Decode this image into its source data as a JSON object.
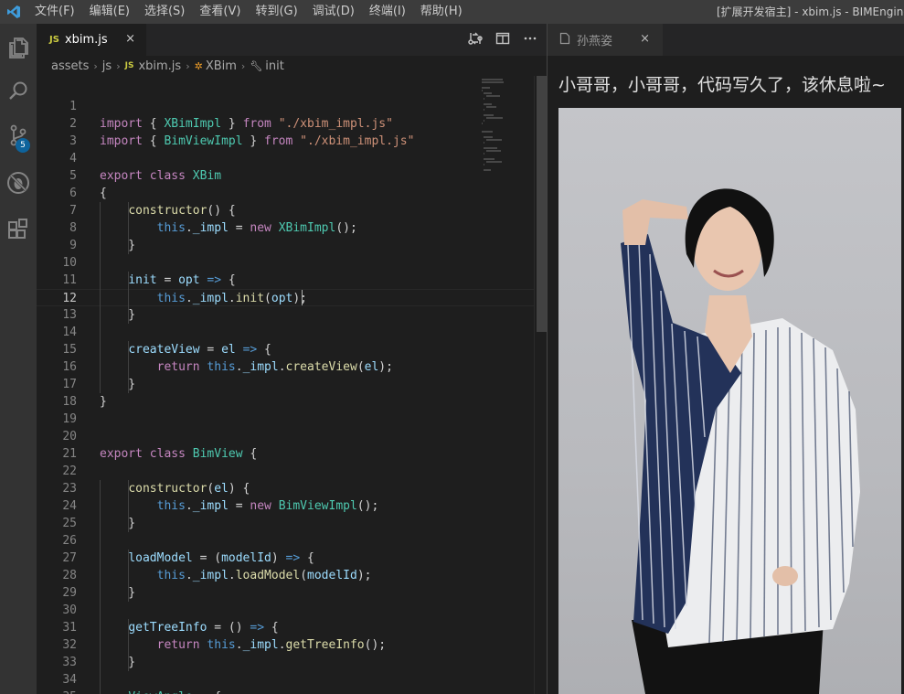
{
  "menu": {
    "items": [
      "文件(F)",
      "编辑(E)",
      "选择(S)",
      "查看(V)",
      "转到(G)",
      "调试(D)",
      "终端(I)",
      "帮助(H)"
    ],
    "window_title": "[扩展开发宿主] - xbim.js - BIMEngineDe"
  },
  "activity_bar": {
    "items": [
      "explorer-icon",
      "search-icon",
      "source-control-icon",
      "debug-icon",
      "extensions-icon"
    ],
    "source_control_badge": "5"
  },
  "editor": {
    "tab": {
      "icon": "JS",
      "label": "xbim.js",
      "close": "×"
    },
    "actions": [
      "compare-changes-icon",
      "split-editor-icon",
      "more-actions-icon"
    ],
    "breadcrumbs": [
      "assets",
      "js",
      "xbim.js",
      "XBim",
      "init"
    ],
    "cursor_line": 12,
    "line_numbers": [
      "1",
      "2",
      "3",
      "4",
      "5",
      "6",
      "7",
      "8",
      "9",
      "10",
      "11",
      "12",
      "13",
      "14",
      "15",
      "16",
      "17",
      "18",
      "19",
      "20",
      "21",
      "22",
      "23",
      "24",
      "25",
      "26",
      "27",
      "28",
      "29",
      "30",
      "31",
      "32",
      "33",
      "34",
      "35"
    ],
    "code_lines": [
      "",
      "import { XBimImpl } from \"./xbim_impl.js\"",
      "import { BimViewImpl } from \"./xbim_impl.js\"",
      "",
      "export class XBim",
      "{",
      "    constructor() {",
      "        this._impl = new XBimImpl();",
      "    }",
      "",
      "    init = opt => {",
      "        this._impl.init(opt);",
      "    }",
      "",
      "    createView = el => {",
      "        return this._impl.createView(el);",
      "    }",
      "}",
      "",
      "",
      "export class BimView {",
      "",
      "    constructor(el) {",
      "        this._impl = new BimViewImpl();",
      "    }",
      "",
      "    loadModel = (modelId) => {",
      "        this._impl.loadModel(modelId);",
      "    }",
      "",
      "    getTreeInfo = () => {",
      "        return this._impl.getTreeInfo();",
      "    }",
      "",
      "    ViewAngle = {"
    ]
  },
  "preview": {
    "tab": {
      "label": "孙燕姿",
      "close": "×"
    },
    "heading": "小哥哥，小哥哥，代码写久了，该休息啦~",
    "image": "portrait-photo"
  },
  "colors": {
    "titlebar": "#3c3c3c",
    "activitybar": "#333333",
    "editor_bg": "#1e1e1e",
    "badge": "#0e639c",
    "keyword": "#c586c0",
    "string": "#ce9178",
    "class": "#4ec9b0",
    "function": "#dcdcaa",
    "variable": "#9cdcfe"
  }
}
